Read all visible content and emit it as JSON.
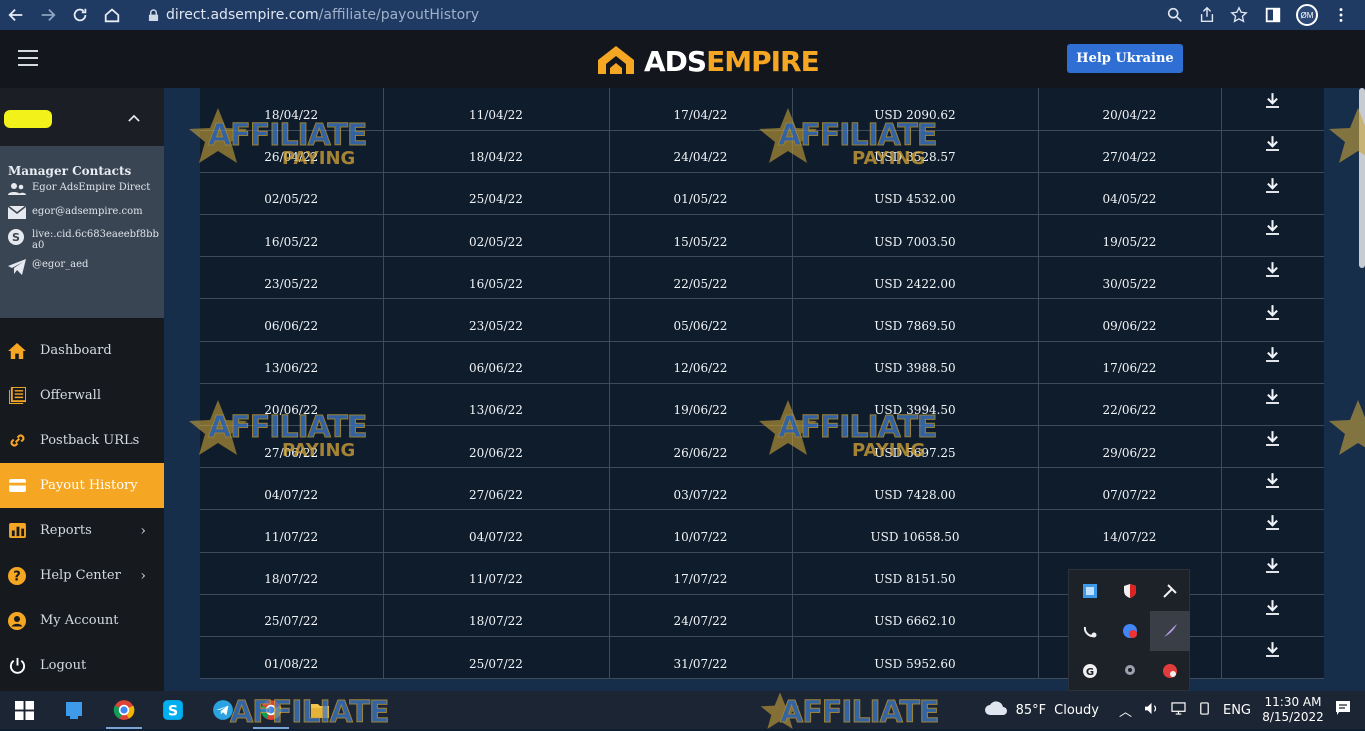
{
  "browser": {
    "url_host": "direct.adsempire.com",
    "url_path": "/affiliate/payoutHistory",
    "profile_initials": "ØM"
  },
  "header": {
    "logo_ads": "ADS",
    "logo_empire": "EMPIRE",
    "help_button": "Help Ukraine"
  },
  "contacts": {
    "title": "Manager Contacts",
    "name": "Egor AdsEmpire Direct",
    "email": "egor@adsempire.com",
    "skype": "live:.cid.6c683eaeebf8bba0",
    "telegram": "@egor_aed"
  },
  "menu": {
    "dashboard": "Dashboard",
    "offerwall": "Offerwall",
    "postback": "Postback URLs",
    "payout_history": "Payout History",
    "reports": "Reports",
    "help_center": "Help Center",
    "my_account": "My Account",
    "logout": "Logout"
  },
  "rows": [
    [
      "18/04/22",
      "11/04/22",
      "17/04/22",
      "USD 2090.62",
      "20/04/22"
    ],
    [
      "26/04/22",
      "18/04/22",
      "24/04/22",
      "USD 3528.57",
      "27/04/22"
    ],
    [
      "02/05/22",
      "25/04/22",
      "01/05/22",
      "USD 4532.00",
      "04/05/22"
    ],
    [
      "16/05/22",
      "02/05/22",
      "15/05/22",
      "USD 7003.50",
      "19/05/22"
    ],
    [
      "23/05/22",
      "16/05/22",
      "22/05/22",
      "USD 2422.00",
      "30/05/22"
    ],
    [
      "06/06/22",
      "23/05/22",
      "05/06/22",
      "USD 7869.50",
      "09/06/22"
    ],
    [
      "13/06/22",
      "06/06/22",
      "12/06/22",
      "USD 3988.50",
      "17/06/22"
    ],
    [
      "20/06/22",
      "13/06/22",
      "19/06/22",
      "USD 3994.50",
      "22/06/22"
    ],
    [
      "27/06/22",
      "20/06/22",
      "26/06/22",
      "USD 5697.25",
      "29/06/22"
    ],
    [
      "04/07/22",
      "27/06/22",
      "03/07/22",
      "USD 7428.00",
      "07/07/22"
    ],
    [
      "11/07/22",
      "04/07/22",
      "10/07/22",
      "USD 10658.50",
      "14/07/22"
    ],
    [
      "18/07/22",
      "11/07/22",
      "17/07/22",
      "USD 8151.50",
      ""
    ],
    [
      "25/07/22",
      "18/07/22",
      "24/07/22",
      "USD 6662.10",
      ""
    ],
    [
      "01/08/22",
      "25/07/22",
      "31/07/22",
      "USD 5952.60",
      ""
    ]
  ],
  "watermark": {
    "line1": "AFFILIATE",
    "line2": "PAYING"
  },
  "taskbar": {
    "temperature": "85°F",
    "condition": "Cloudy",
    "language": "ENG",
    "time": "11:30 AM",
    "date": "8/15/2022"
  },
  "colors": {
    "accent": "#f5a623",
    "help_button": "#2f6fd3",
    "sidebar_bg": "#16191e",
    "table_bg": "#0f1c2b"
  }
}
